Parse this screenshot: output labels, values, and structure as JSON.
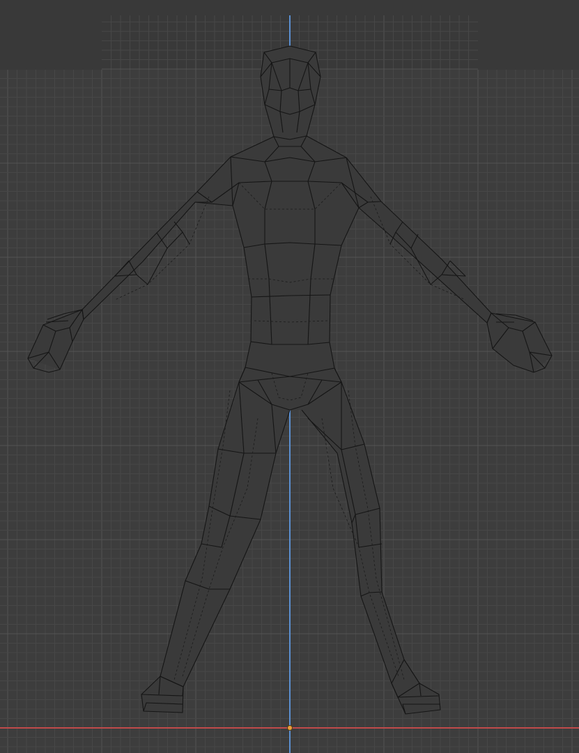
{
  "viewport": {
    "view": "front-orthographic",
    "shading": "wireframe",
    "background_color": "#3d3d3d",
    "grid_minor_color": "#474747",
    "grid_major_color": "#545454",
    "axis_z_color": "#5b8fd0",
    "axis_x_color": "#c04a4a",
    "origin_color": "#e8a03c",
    "object": {
      "name_icon": "mesh-icon",
      "type": "low-poly humanoid mesh",
      "pose": "A-pose"
    }
  }
}
